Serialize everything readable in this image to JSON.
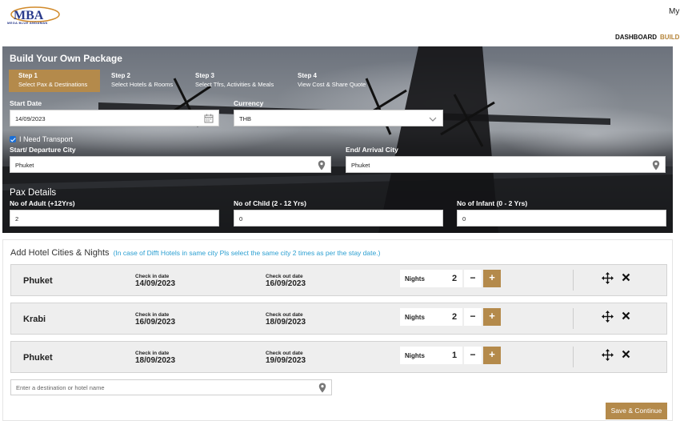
{
  "header": {
    "logo_text": "MBA",
    "logo_subtitle": "MEGA BLUE ANDAMAN",
    "my_account_label": "My",
    "nav": {
      "dashboard": "DASHBOARD",
      "build": "BUILD"
    }
  },
  "builder": {
    "title": "Build Your Own Package",
    "steps": [
      {
        "num": "Step 1",
        "label": "Select Pax & Destinations",
        "active": true
      },
      {
        "num": "Step 2",
        "label": "Select Hotels & Rooms",
        "active": false
      },
      {
        "num": "Step 3",
        "label": "Select Tfrs, Activities & Meals",
        "active": false
      },
      {
        "num": "Step 4",
        "label": "View Cost & Share Quote",
        "active": false
      }
    ],
    "start_date_label": "Start Date",
    "start_date_value": "14/09/2023",
    "currency_label": "Currency",
    "currency_value": "THB",
    "transport_label": "I Need Transport",
    "transport_checked": true,
    "start_city_label": "Start/ Departure City",
    "start_city_value": "Phuket",
    "end_city_label": "End/ Arrival City",
    "end_city_value": "Phuket",
    "pax_title": "Pax Details",
    "adult_label": "No of Adult (+12Yrs)",
    "adult_value": "2",
    "child_label": "No of Child (2 - 12 Yrs)",
    "child_value": "0",
    "infant_label": "No of Infant (0 - 2 Yrs)",
    "infant_value": "0"
  },
  "hotels": {
    "title": "Add Hotel Cities & Nights",
    "hint": "(In case of Difft Hotels in same city Pls select the same city 2 times as per the stay date.)",
    "checkin_label": "Check in date",
    "checkout_label": "Check out date",
    "nights_label": "Nights",
    "minus": "−",
    "plus": "+",
    "rows": [
      {
        "city": "Phuket",
        "checkin": "14/09/2023",
        "checkout": "16/09/2023",
        "nights": "2"
      },
      {
        "city": "Krabi",
        "checkin": "16/09/2023",
        "checkout": "18/09/2023",
        "nights": "2"
      },
      {
        "city": "Phuket",
        "checkin": "18/09/2023",
        "checkout": "19/09/2023",
        "nights": "1"
      }
    ],
    "destination_placeholder": "Enter a destination or hotel name",
    "save_label": "Save & Continue"
  },
  "colors": {
    "accent": "#b48a4b",
    "hint": "#2b9fd1",
    "checkbox": "#1b6fd6"
  },
  "icons": [
    "calendar-icon",
    "chevron-down-icon",
    "location-pin-icon",
    "move-icon",
    "close-icon"
  ]
}
